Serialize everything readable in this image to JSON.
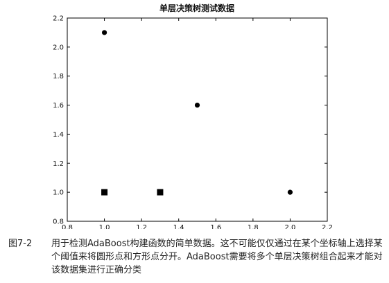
{
  "chart_data": {
    "type": "scatter",
    "title": "单层决策树测试数据",
    "xlabel": "",
    "ylabel": "",
    "xlim": [
      0.8,
      2.2
    ],
    "ylim": [
      0.8,
      2.2
    ],
    "xticks": [
      "0.8",
      "1.0",
      "1.2",
      "1.4",
      "1.6",
      "1.8",
      "2.0",
      "2.2"
    ],
    "yticks": [
      "0.8",
      "1.0",
      "1.2",
      "1.4",
      "1.6",
      "1.8",
      "2.0",
      "2.2"
    ],
    "grid": false,
    "series": [
      {
        "marker": "circle",
        "color": "#000000",
        "points": [
          {
            "x": 1.0,
            "y": 2.1
          },
          {
            "x": 1.5,
            "y": 1.6
          },
          {
            "x": 2.0,
            "y": 1.0
          }
        ]
      },
      {
        "marker": "square",
        "color": "#000000",
        "points": [
          {
            "x": 1.0,
            "y": 1.0
          },
          {
            "x": 1.3,
            "y": 1.0
          }
        ]
      }
    ]
  },
  "caption": {
    "label": "图7-2",
    "text": "用于检测AdaBoost构建函数的简单数据。这不可能仅仅通过在某个坐标轴上选择某个阈值来将圆形点和方形点分开。AdaBoost需要将多个单层决策树组合起来才能对该数据集进行正确分类"
  }
}
